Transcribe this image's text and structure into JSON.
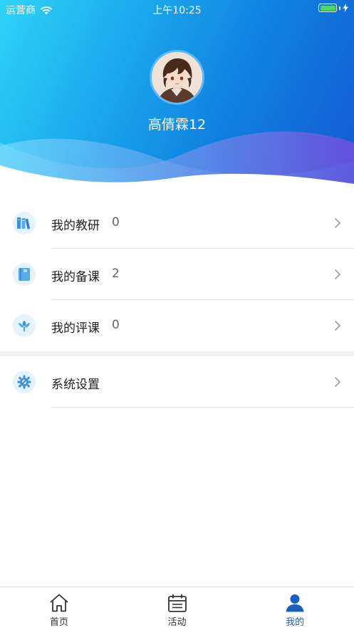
{
  "status_bar": {
    "carrier": "运营商",
    "time": "上午10:25"
  },
  "profile": {
    "name": "高倩霖12"
  },
  "menu": {
    "items": [
      {
        "label": "我的教研",
        "count": "0",
        "icon": "books-icon"
      },
      {
        "label": "我的备课",
        "count": "2",
        "icon": "notebook-icon"
      },
      {
        "label": "我的评课",
        "count": "0",
        "icon": "leaf-icon"
      }
    ],
    "settings": {
      "label": "系统设置",
      "icon": "settings-icon"
    }
  },
  "tabbar": {
    "tabs": [
      {
        "label": "首页",
        "icon": "home-icon",
        "active": false
      },
      {
        "label": "活动",
        "icon": "calendar-icon",
        "active": false
      },
      {
        "label": "我的",
        "icon": "user-icon",
        "active": true
      }
    ]
  },
  "colors": {
    "accent": "#1a5fc4",
    "header_start": "#2fd3f7",
    "header_end": "#1459d3",
    "battery": "#4cd964"
  }
}
